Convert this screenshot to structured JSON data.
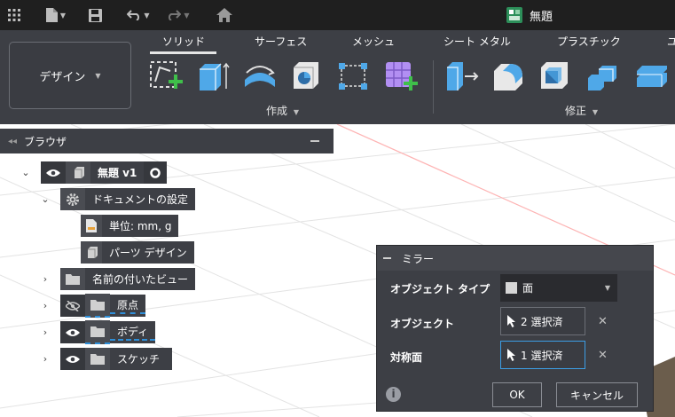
{
  "titlebar": {
    "document_title": "無題"
  },
  "ribbon": {
    "workspace_label": "デザイン",
    "tabs": [
      "ソリッド",
      "サーフェス",
      "メッシュ",
      "シート メタル",
      "プラスチック",
      "ユ"
    ],
    "active_tab": "ソリッド",
    "groups": {
      "create": "作成",
      "modify": "修正"
    }
  },
  "browser": {
    "title": "ブラウザ",
    "nodes": {
      "root": "無題 v1",
      "doc_settings": "ドキュメントの設定",
      "units": "単位: mm, g",
      "parts_design": "パーツ デザイン",
      "named_views": "名前の付いたビュー",
      "origin": "原点",
      "bodies": "ボディ",
      "sketches": "スケッチ"
    }
  },
  "mirror_dialog": {
    "title": "ミラー",
    "object_type_label": "オブジェクト タイプ",
    "object_type_value": "面",
    "objects_label": "オブジェクト",
    "objects_value": "2 選択済",
    "mirror_plane_label": "対称面",
    "mirror_plane_value": "1 選択済",
    "ok": "OK",
    "cancel": "キャンセル"
  },
  "colors": {
    "accent": "#3c9ee5",
    "panel": "#3d3f45",
    "titlebar": "#1f1f1f",
    "create_icon_green": "#3fbf4a"
  }
}
